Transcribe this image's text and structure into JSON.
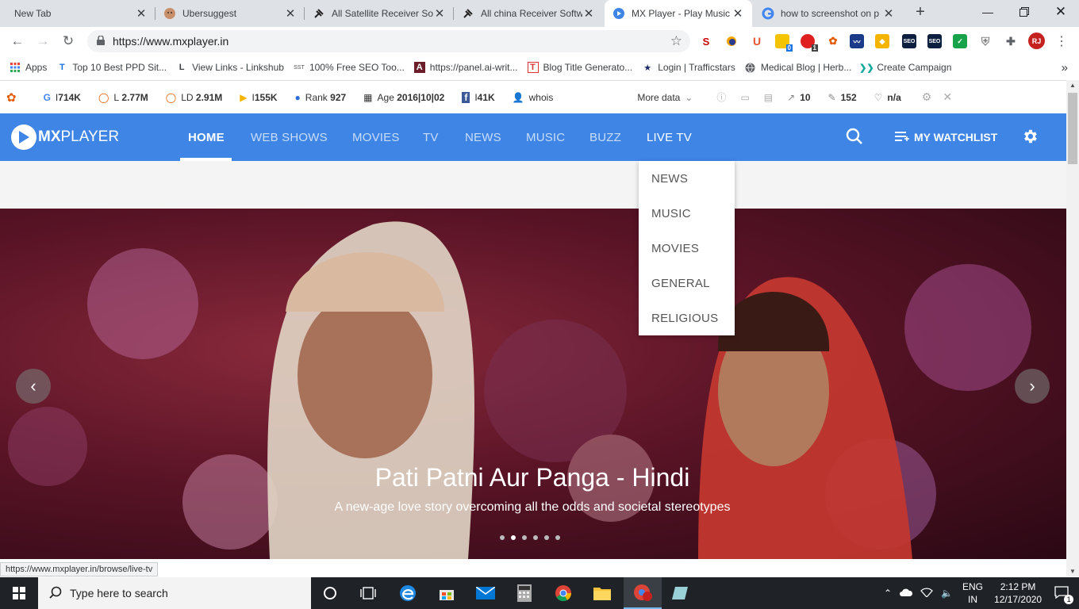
{
  "tabs": [
    {
      "label": "New Tab"
    },
    {
      "label": "Ubersuggest"
    },
    {
      "label": "All Satellite Receiver So"
    },
    {
      "label": "All china Receiver Softw"
    },
    {
      "label": "MX Player - Play Music"
    },
    {
      "label": "how to screenshot on p"
    }
  ],
  "address": {
    "url": "https://www.mxplayer.in"
  },
  "avatar_initials": "RJ",
  "extensions": {
    "badge_1": "0",
    "badge_2": "1",
    "seo_label_1": "SEO",
    "seo_label_2": "SEO",
    "u_label": "U"
  },
  "bookmarks": [
    {
      "label": "Apps"
    },
    {
      "label": "Top 10 Best PPD Sit..."
    },
    {
      "label": "View Links - Linkshub"
    },
    {
      "label": "100% Free SEO Too..."
    },
    {
      "label": "https://panel.ai-writ..."
    },
    {
      "label": "Blog Title Generato..."
    },
    {
      "label": "Login | Trafficstars"
    },
    {
      "label": "Medical Blog | Herb..."
    },
    {
      "label": "Create Campaign"
    }
  ],
  "seobar": {
    "g_label": "I",
    "g_value": "714K",
    "l_label": "L",
    "l_value": "2.77M",
    "ld_label": "LD",
    "ld_value": "2.91M",
    "i_label": "I",
    "i_value": "155K",
    "rank_label": "Rank",
    "rank_value": "927",
    "age_label": "Age",
    "age_value": "2016|10|02",
    "fb_label": "I",
    "fb_value": "41K",
    "whois": "whois",
    "more": "More data",
    "links_value": "10",
    "pages_value": "152",
    "na_value": "n/a"
  },
  "mx": {
    "logo_bold": "MX",
    "logo_light": "PLAYER",
    "nav": [
      {
        "label": "HOME"
      },
      {
        "label": "WEB SHOWS"
      },
      {
        "label": "MOVIES"
      },
      {
        "label": "TV"
      },
      {
        "label": "NEWS"
      },
      {
        "label": "MUSIC"
      },
      {
        "label": "BUZZ"
      },
      {
        "label": "LIVE TV"
      }
    ],
    "watchlist": "MY WATCHLIST",
    "livetv_menu": [
      "NEWS",
      "MUSIC",
      "MOVIES",
      "GENERAL",
      "RELIGIOUS"
    ]
  },
  "hero": {
    "title": "Pati Patni Aur Panga - Hindi",
    "subtitle": "A new-age love story overcoming all the odds and societal stereotypes",
    "slide_count": 6,
    "active_slide_index": 1
  },
  "status_url": "https://www.mxplayer.in/browse/live-tv",
  "taskbar": {
    "search_placeholder": "Type here to search",
    "lang_top": "ENG",
    "lang_bottom": "IN",
    "time": "2:12 PM",
    "date": "12/17/2020",
    "notif_count": "1"
  }
}
